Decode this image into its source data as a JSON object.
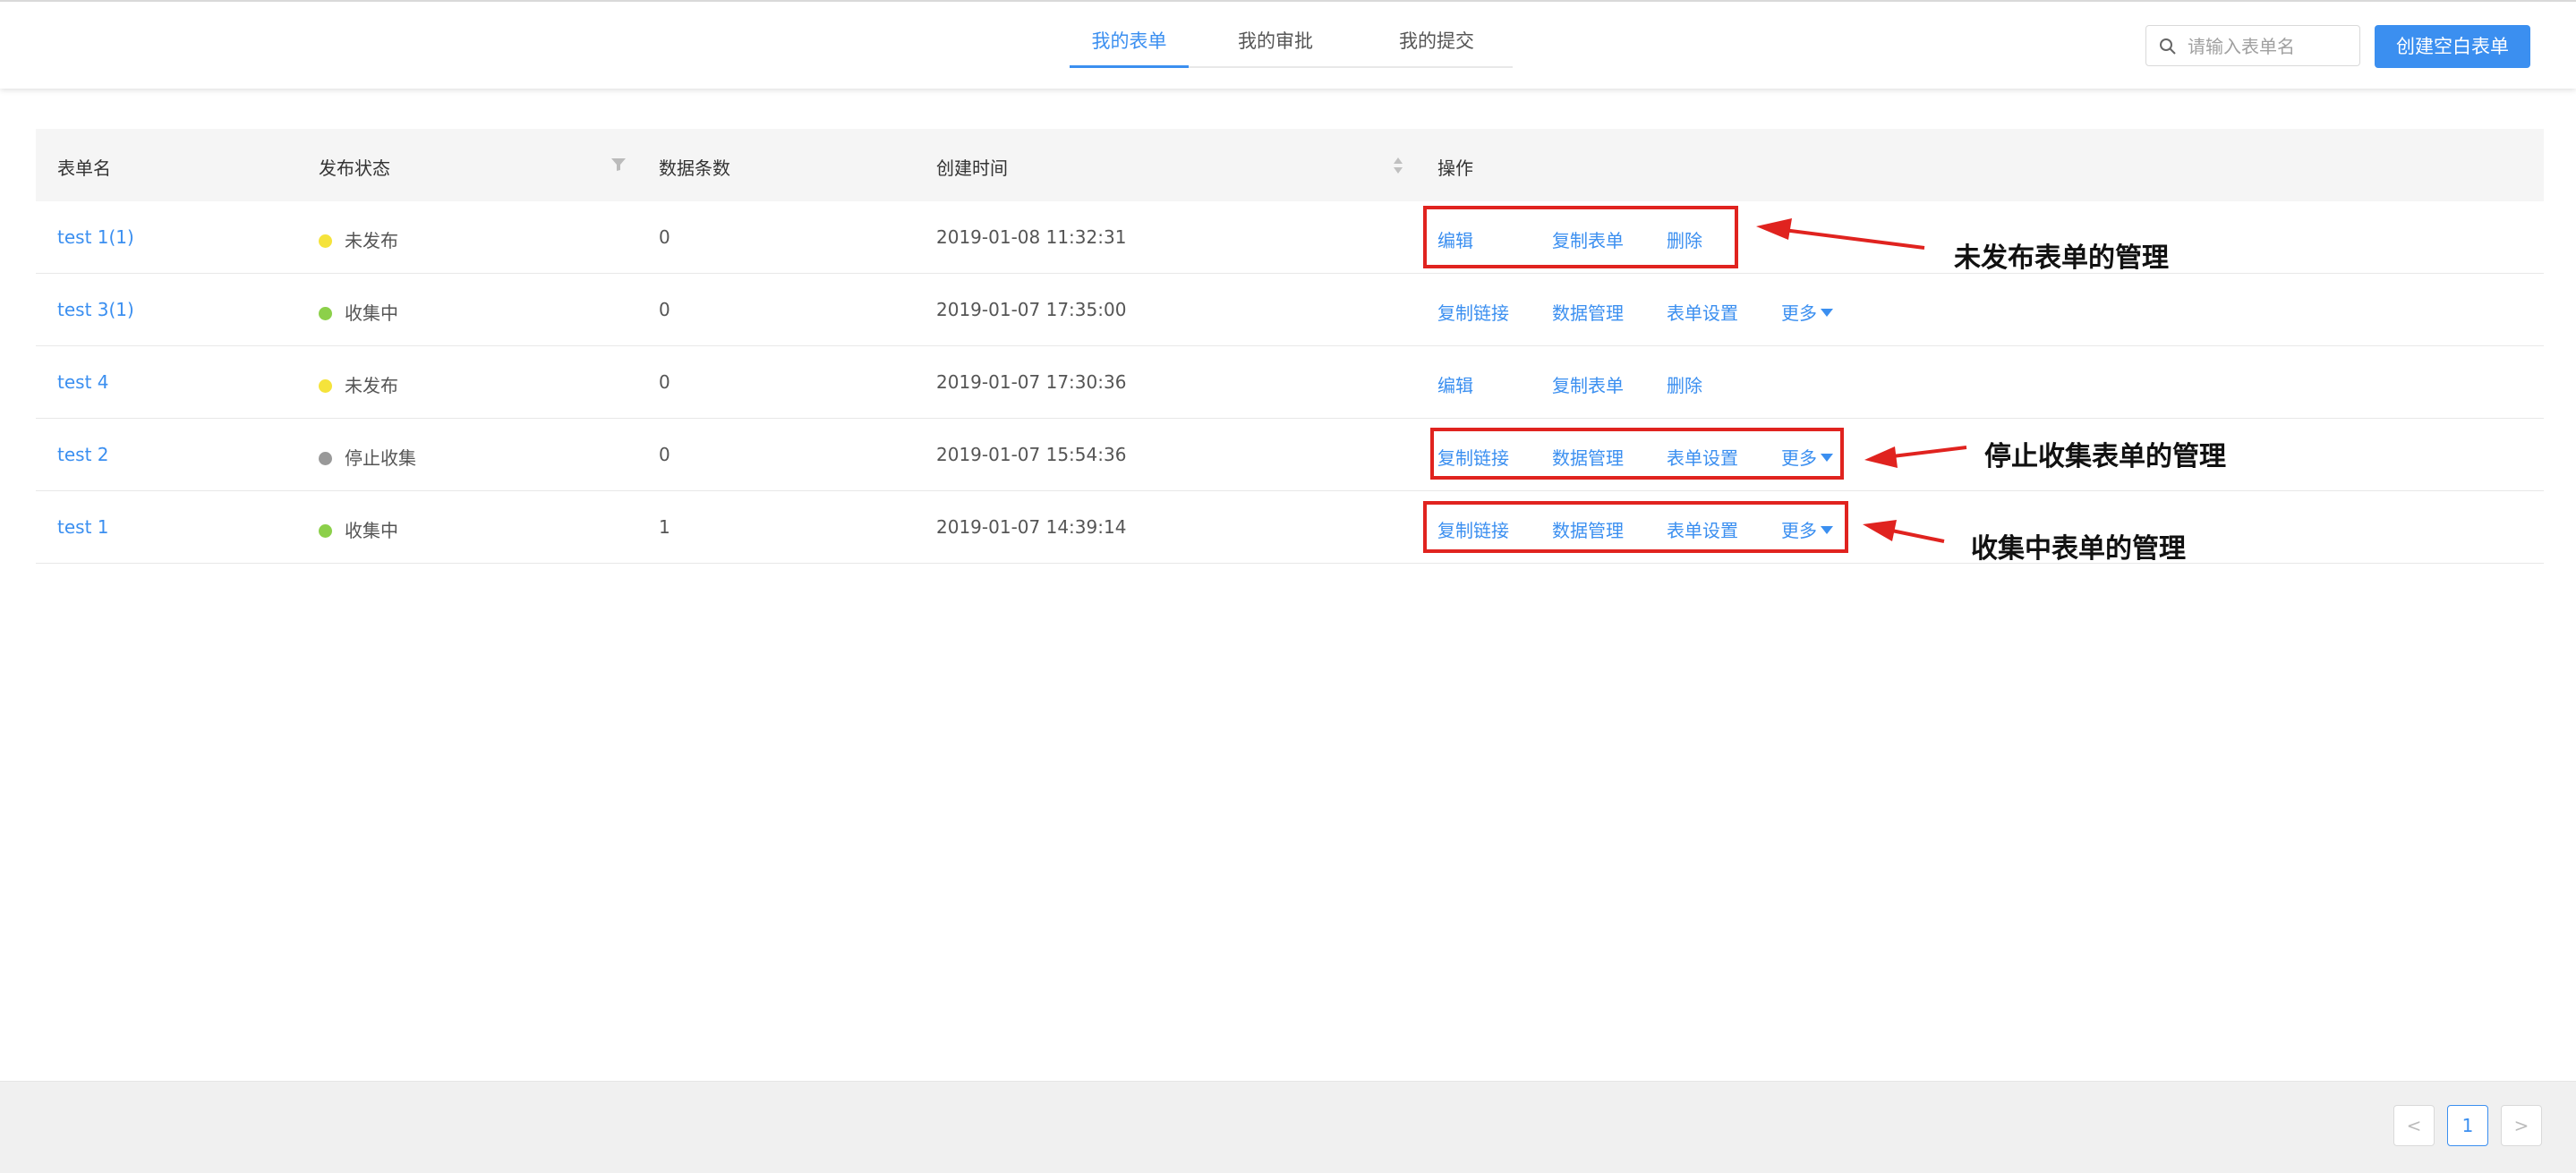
{
  "header": {
    "tabs": [
      {
        "label": "我的表单",
        "active": true
      },
      {
        "label": "我的审批",
        "active": false
      },
      {
        "label": "我的提交",
        "active": false
      }
    ],
    "search": {
      "placeholder": "请输入表单名",
      "value": ""
    },
    "create_button": "创建空白表单"
  },
  "table": {
    "columns": [
      "表单名",
      "发布状态",
      "数据条数",
      "创建时间",
      "操作"
    ],
    "rows": [
      {
        "name": "test 1(1)",
        "status": "未发布",
        "status_color": "#f5e33b",
        "count": "0",
        "created": "2019-01-08 11:32:31",
        "actions": [
          "编辑",
          "复制表单",
          "删除"
        ]
      },
      {
        "name": "test 3(1)",
        "status": "收集中",
        "status_color": "#8cd04a",
        "count": "0",
        "created": "2019-01-07 17:35:00",
        "actions": [
          "复制链接",
          "数据管理",
          "表单设置",
          "更多"
        ]
      },
      {
        "name": "test 4",
        "status": "未发布",
        "status_color": "#f5e33b",
        "count": "0",
        "created": "2019-01-07 17:30:36",
        "actions": [
          "编辑",
          "复制表单",
          "删除"
        ]
      },
      {
        "name": "test 2",
        "status": "停止收集",
        "status_color": "#999999",
        "count": "0",
        "created": "2019-01-07 15:54:36",
        "actions": [
          "复制链接",
          "数据管理",
          "表单设置",
          "更多"
        ]
      },
      {
        "name": "test 1",
        "status": "收集中",
        "status_color": "#8cd04a",
        "count": "1",
        "created": "2019-01-07 14:39:14",
        "actions": [
          "复制链接",
          "数据管理",
          "表单设置",
          "更多"
        ]
      }
    ]
  },
  "annotations": [
    "未发布表单的管理",
    "停止收集表单的管理",
    "收集中表单的管理"
  ],
  "pagination": {
    "prev": "<",
    "current": "1",
    "next": ">"
  },
  "colors": {
    "accent": "#3b8ff0",
    "highlight": "#e0231f"
  }
}
